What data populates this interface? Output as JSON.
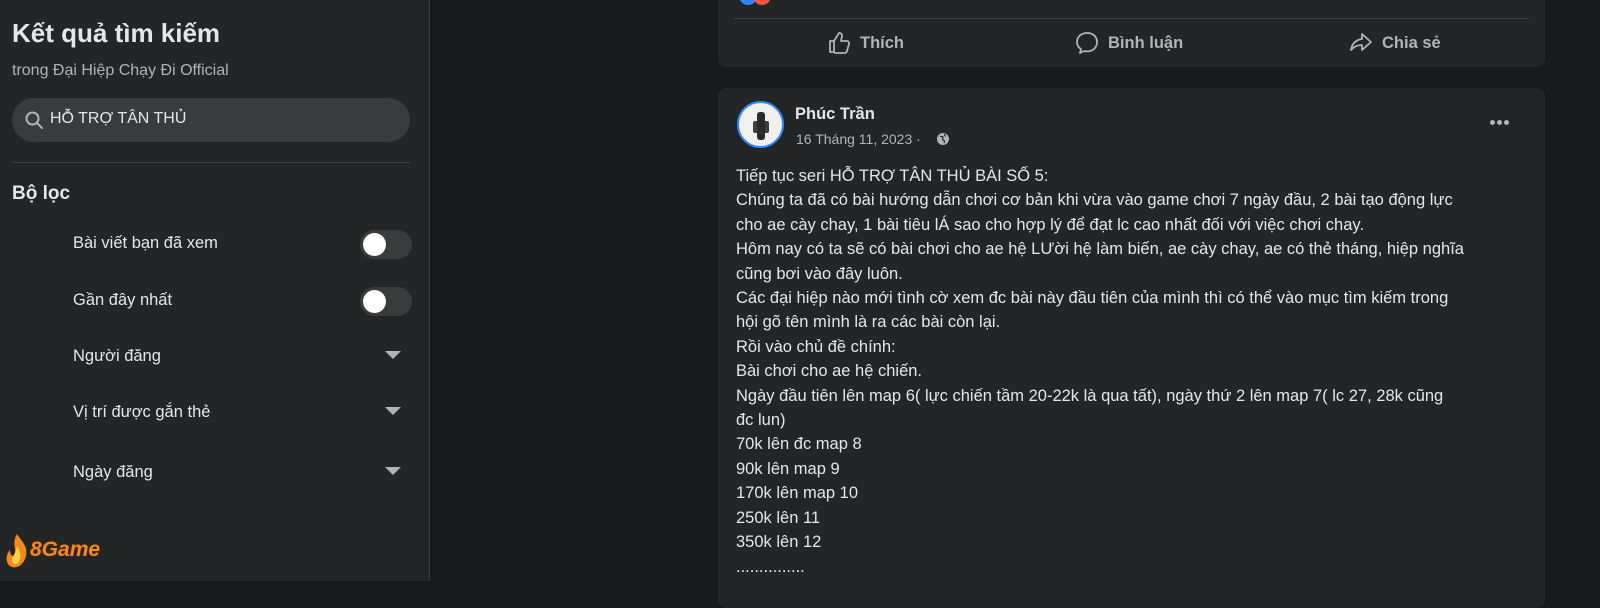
{
  "sidebar": {
    "title": "Kết quả tìm kiếm",
    "subtitle": "trong Đại Hiệp Chạy Đi Official",
    "search": {
      "value": "HỖ TRỢ TÂN THỦ",
      "icon": "search-icon"
    },
    "filter_heading": "Bộ lọc",
    "filters": [
      {
        "label": "Bài viết bạn đã xem",
        "type": "toggle",
        "on": false
      },
      {
        "label": "Gần đây nhất",
        "type": "toggle",
        "on": false
      },
      {
        "label": "Người đăng",
        "type": "dropdown"
      },
      {
        "label": "Vị trí được gắn thẻ",
        "type": "dropdown"
      },
      {
        "label": "Ngày đăng",
        "type": "dropdown"
      }
    ]
  },
  "watermark": {
    "text": "8Game"
  },
  "post1": {
    "actions": [
      {
        "label": "Thích",
        "icon": "like-icon"
      },
      {
        "label": "Bình luận",
        "icon": "comment-icon"
      },
      {
        "label": "Chia sẻ",
        "icon": "share-icon"
      }
    ]
  },
  "post2": {
    "author": "Phúc Trần",
    "date": "16 Tháng 11, 2023 ·",
    "lines": [
      "Tiếp tục seri HỖ TRỢ TÂN THỦ BÀI SỐ 5:",
      "Chúng ta đã có bài hướng dẫn chơi cơ bản khi vừa vào game chơi 7 ngày đầu, 2 bài tạo động lực",
      "cho ae cày chay, 1 bài tiêu lÁ sao cho hợp lý để đạt lc cao nhất đối với việc chơi chay.",
      "Hôm nay có ta sẽ có bài chơi cho ae hệ LƯời hệ làm biến, ae cày chay, ae có thẻ tháng, hiệp nghĩa",
      "cũng bơi vào đây luôn.",
      "Các đại hiệp nào mới tình cờ xem đc bài này đầu tiên của mình thì có thể vào mục tìm kiếm trong",
      "hội gõ tên mình là ra các bài còn lại.",
      "Rồi vào chủ đề chính:",
      "Bài chơi cho ae hệ chiến.",
      "Ngày đầu tiên lên map 6( lực chiến tầm 20-22k là qua tất), ngày thứ 2 lên map 7( lc 27, 28k cũng",
      "đc lun)",
      "70k lên đc map 8",
      "90k lên map 9",
      "170k lên map 10",
      "250k lên 11",
      "350k lên 12",
      "..............."
    ]
  },
  "colors": {
    "bg": "#18191a",
    "card": "#242526",
    "text": "#e4e6eb",
    "muted": "#b0b3b8",
    "accent": "#2d88ff"
  }
}
